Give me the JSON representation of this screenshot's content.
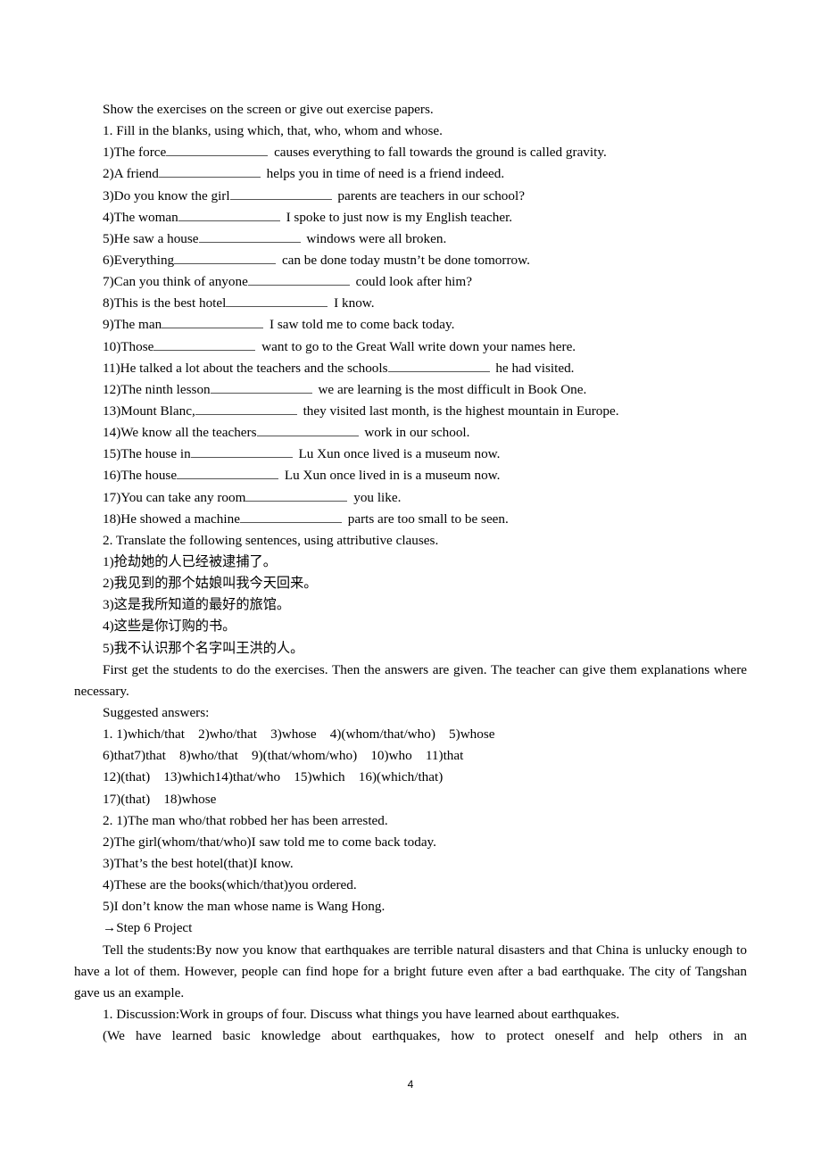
{
  "intro": "Show the exercises on the screen or give out exercise papers.",
  "exercise1": {
    "heading": "1. Fill in the blanks, using which, that, who, whom and whose.",
    "items": [
      {
        "before": "1)The force",
        "after": " causes everything to fall towards the ground is called gravity."
      },
      {
        "before": "2)A friend",
        "after": " helps you in time of need is a friend indeed."
      },
      {
        "before": "3)Do you know the girl",
        "after": " parents are teachers in our school?"
      },
      {
        "before": "4)The woman",
        "after": " I spoke to just now is my English teacher."
      },
      {
        "before": "5)He saw a house",
        "after": " windows were all broken."
      },
      {
        "before": "6)Everything",
        "after": " can be done today mustn’t be done tomorrow."
      },
      {
        "before": "7)Can you think of anyone",
        "after": " could look after him?"
      },
      {
        "before": "8)This is the best hotel",
        "after": " I know."
      },
      {
        "before": "9)The man",
        "after": " I saw told me to come back today."
      },
      {
        "before": "10)Those",
        "after": " want to go to the Great Wall write down your names here."
      },
      {
        "before": "11)He talked a lot about the teachers and the schools",
        "after": " he had visited."
      },
      {
        "before": "12)The ninth lesson",
        "after": " we are learning is the most difficult in Book One."
      },
      {
        "before": "13)Mount Blanc,",
        "after": " they visited last month, is the highest mountain in Europe."
      },
      {
        "before": "14)We know all the teachers",
        "after": " work in our school."
      },
      {
        "before": "15)The house in",
        "after": " Lu Xun once lived is a museum now."
      },
      {
        "before": "16)The house",
        "after": " Lu Xun once lived in is a museum now."
      },
      {
        "before": "17)You can take any room",
        "after": " you like."
      },
      {
        "before": "18)He showed a machine",
        "after": " parts are too small to be seen."
      }
    ]
  },
  "exercise2": {
    "heading": "2. Translate the following sentences, using attributive clauses.",
    "items": [
      "1)抢劫她的人已经被逮捕了。",
      "2)我见到的那个姑娘叫我今天回来。",
      "3)这是我所知道的最好的旅馆。",
      "4)这些是你订购的书。",
      "5)我不认识那个名字叫王洪的人。"
    ]
  },
  "instructions": "First get the students to do the exercises. Then the answers are given. The teacher can give them explanations where necessary.",
  "answers": {
    "heading": "Suggested answers:",
    "part1_lines": [
      "1. 1)which/that    2)who/that    3)whose    4)(whom/that/who)    5)whose",
      "6)that7)that    8)who/that    9)(that/whom/who)    10)who    11)that",
      "12)(that)    13)which14)that/who    15)which    16)(which/that)",
      "17)(that)    18)whose"
    ],
    "part2_lines": [
      "2. 1)The man who/that robbed her has been arrested.",
      "2)The girl(whom/that/who)I saw told me to come back today.",
      "3)That’s the best hotel(that)I know.",
      "4)These are the books(which/that)you ordered.",
      "5)I don’t know the man whose name is Wang Hong."
    ]
  },
  "step6": {
    "heading": "→Step 6 Project",
    "tell": "Tell the students:By now you know that earthquakes are terrible natural disasters and that China is unlucky enough to have a lot of them. However, people can find hope for a bright future even after a bad earthquake. The city of Tangshan gave us an example.",
    "discussion": "1. Discussion:Work in groups of four. Discuss what things you have learned about earthquakes.",
    "discussion_answer": "(We have learned basic knowledge about earthquakes, how to protect oneself and help others in an"
  },
  "page_number": "4"
}
